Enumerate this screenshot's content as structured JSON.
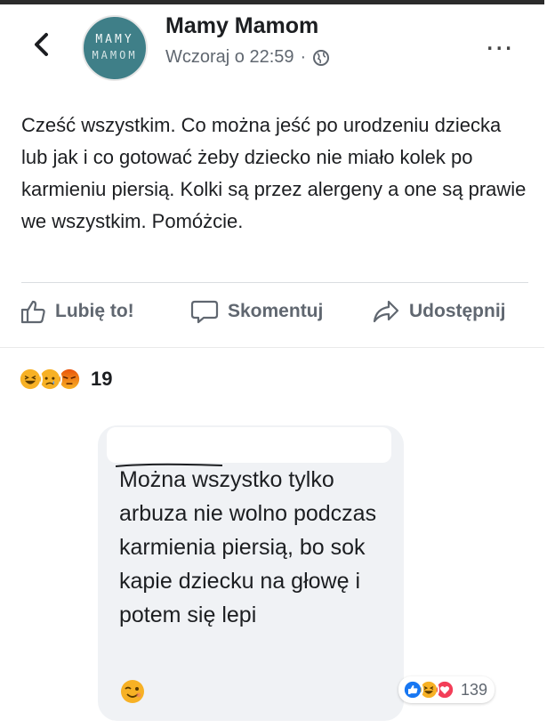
{
  "post": {
    "author": "Mamy Mamom",
    "avatar_text_line1": "MAMY",
    "avatar_text_line2": "MAMOM",
    "timestamp": "Wczoraj o 22:59",
    "dot": "·",
    "more": "...",
    "text": "Cześć wszystkim. Co można jeść po urodzeniu dziecka lub jak i co gotować żeby dziecko nie miało kolek po karmieniu piersią. Kolki są przez alergeny a one są prawie we wszystkim. Pomóżcie.",
    "reaction_count": "19",
    "reaction_icons": [
      "haha-emoji-icon",
      "sad-emoji-icon",
      "angry-emoji-icon"
    ]
  },
  "actions": {
    "like": "Lubię to!",
    "comment": "Skomentuj",
    "share": "Udostępnij"
  },
  "comment": {
    "text": "Można wszystko tylko arbuza nie wolno podczas karmienia piersią, bo sok kapie dziecku na głowę i potem się lepi",
    "emoji": "wink-emoji-icon",
    "reaction_count": "139",
    "reaction_icons": [
      "like-icon",
      "haha-emoji-icon",
      "love-icon"
    ]
  },
  "colors": {
    "avatar_bg": "#3f7f88",
    "secondary_text": "#606770",
    "bubble_bg": "#f0f2f5",
    "like_blue": "#1877f2",
    "love_red": "#f33e58",
    "emoji_yellow": "#f7b125"
  }
}
